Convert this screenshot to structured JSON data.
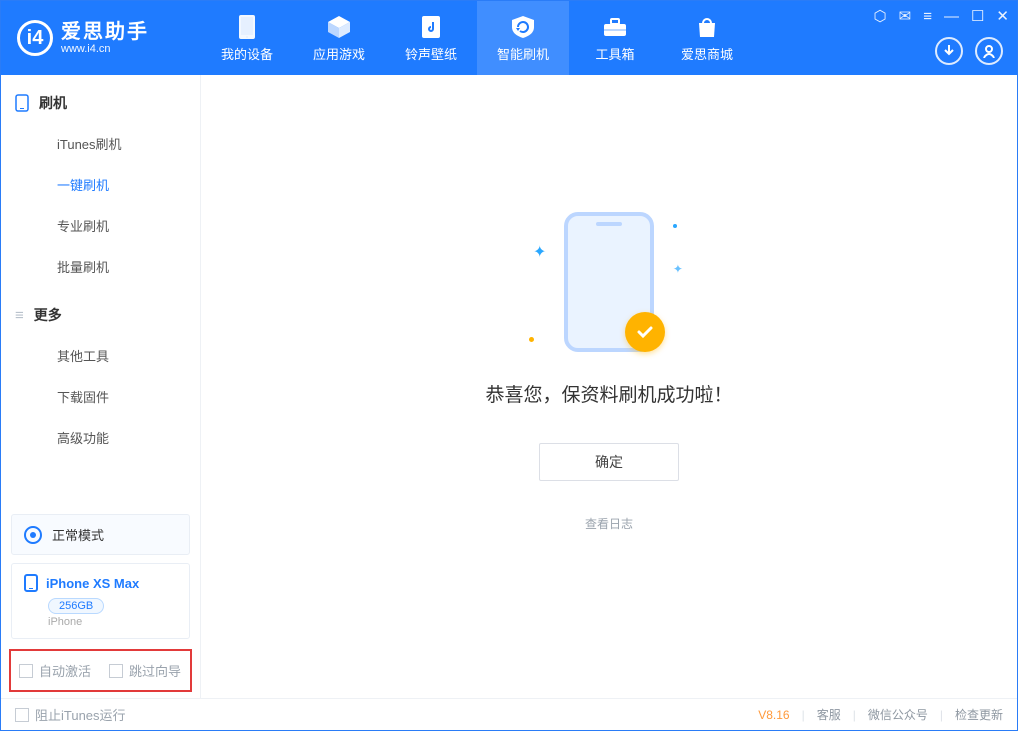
{
  "brand": {
    "name": "爱思助手",
    "url": "www.i4.cn"
  },
  "nav": {
    "tabs": [
      {
        "label": "我的设备"
      },
      {
        "label": "应用游戏"
      },
      {
        "label": "铃声壁纸"
      },
      {
        "label": "智能刷机"
      },
      {
        "label": "工具箱"
      },
      {
        "label": "爱思商城"
      }
    ],
    "active_index": 3
  },
  "sidebar": {
    "section1_title": "刷机",
    "section1_items": [
      "iTunes刷机",
      "一键刷机",
      "专业刷机",
      "批量刷机"
    ],
    "section1_active_index": 1,
    "section2_title": "更多",
    "section2_items": [
      "其他工具",
      "下载固件",
      "高级功能"
    ]
  },
  "status_card": {
    "label": "正常模式"
  },
  "device": {
    "name": "iPhone XS Max",
    "capacity": "256GB",
    "type": "iPhone"
  },
  "options": {
    "auto_activate": "自动激活",
    "skip_guide": "跳过向导"
  },
  "main": {
    "message": "恭喜您，保资料刷机成功啦！",
    "ok_button": "确定",
    "log_link": "查看日志"
  },
  "footer": {
    "block_itunes": "阻止iTunes运行",
    "version": "V8.16",
    "links": [
      "客服",
      "微信公众号",
      "检查更新"
    ]
  }
}
